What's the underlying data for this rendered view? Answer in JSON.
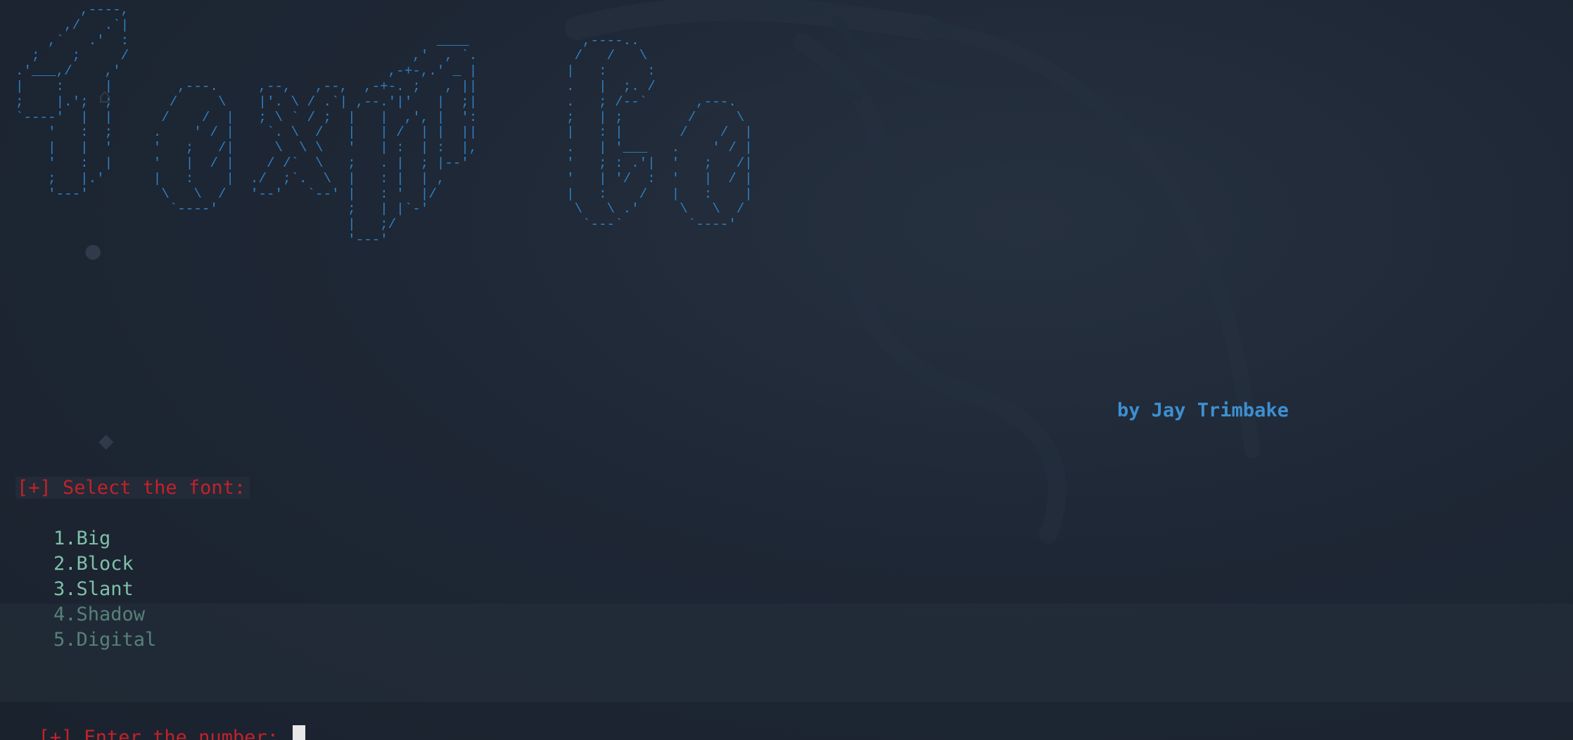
{
  "banner": {
    "ascii": "        ,----,                                                                                        \n      ,/   .`|                                                                                        \n    ,`   .'  :                                      ____              ,----..                         \n  ;    ;     /                                   ,'  , `.            /   /   \\                        \n.'___,/    ,'                                 ,-+-,.' _ |           |   :     :                       \n|    :     |        ,---.     ,--,   ,--,  ,-+-. ;   , ||           .   |  ;. /                       \n;    |.';  ;       /     \\    |'. \\ / .`| ,--.'|'   |  ;|           .   ; /--`      ,---.             \n`----'  |  |      /    /  |   ; \\ ` / ;  |   |  ,', |  ':           ;   | ;        /     \\            \n    '   :  ;     .    ' / |    `. \\  /   |   | /  | |  ||           |   : |       /    /  |           \n    |   |  '     '   ;   /|     \\  \\ \\   '   | :  | :  |,           .   | '___   .    ' / |           \n    '   :  |     '   |  / |    / /`  \\   ;   . |  ; |--'            '   ; : .'|  '   ;   /|           \n    ;   |.'      |   :    |  ./  ;`.  \\  |   : |  | ,               '   | '/  :  '   |  / |           \n    '---'         \\   \\  /   '--'   `--' |   : '  |/                |   :    /   |   :    |           \n                   `----'                ;   | |`-'                  \\   \\ .'     \\   \\  /            \n                                         |   ;/                       `---`        `----'             \n                                         '---'                                                        "
  },
  "author": "by Jay Trimbake",
  "menu": {
    "select_prompt": "[+] Select the font:",
    "options": [
      "1.Big",
      "2.Block",
      "3.Slant",
      "4.Shadow",
      "5.Digital"
    ],
    "enter_prompt": "[+] Enter the number: "
  },
  "colors": {
    "background": "#1d2633",
    "banner": "#2f7fc1",
    "prompt": "#c4212b",
    "options": "#7fc0a8",
    "author": "#3d8fd0"
  }
}
